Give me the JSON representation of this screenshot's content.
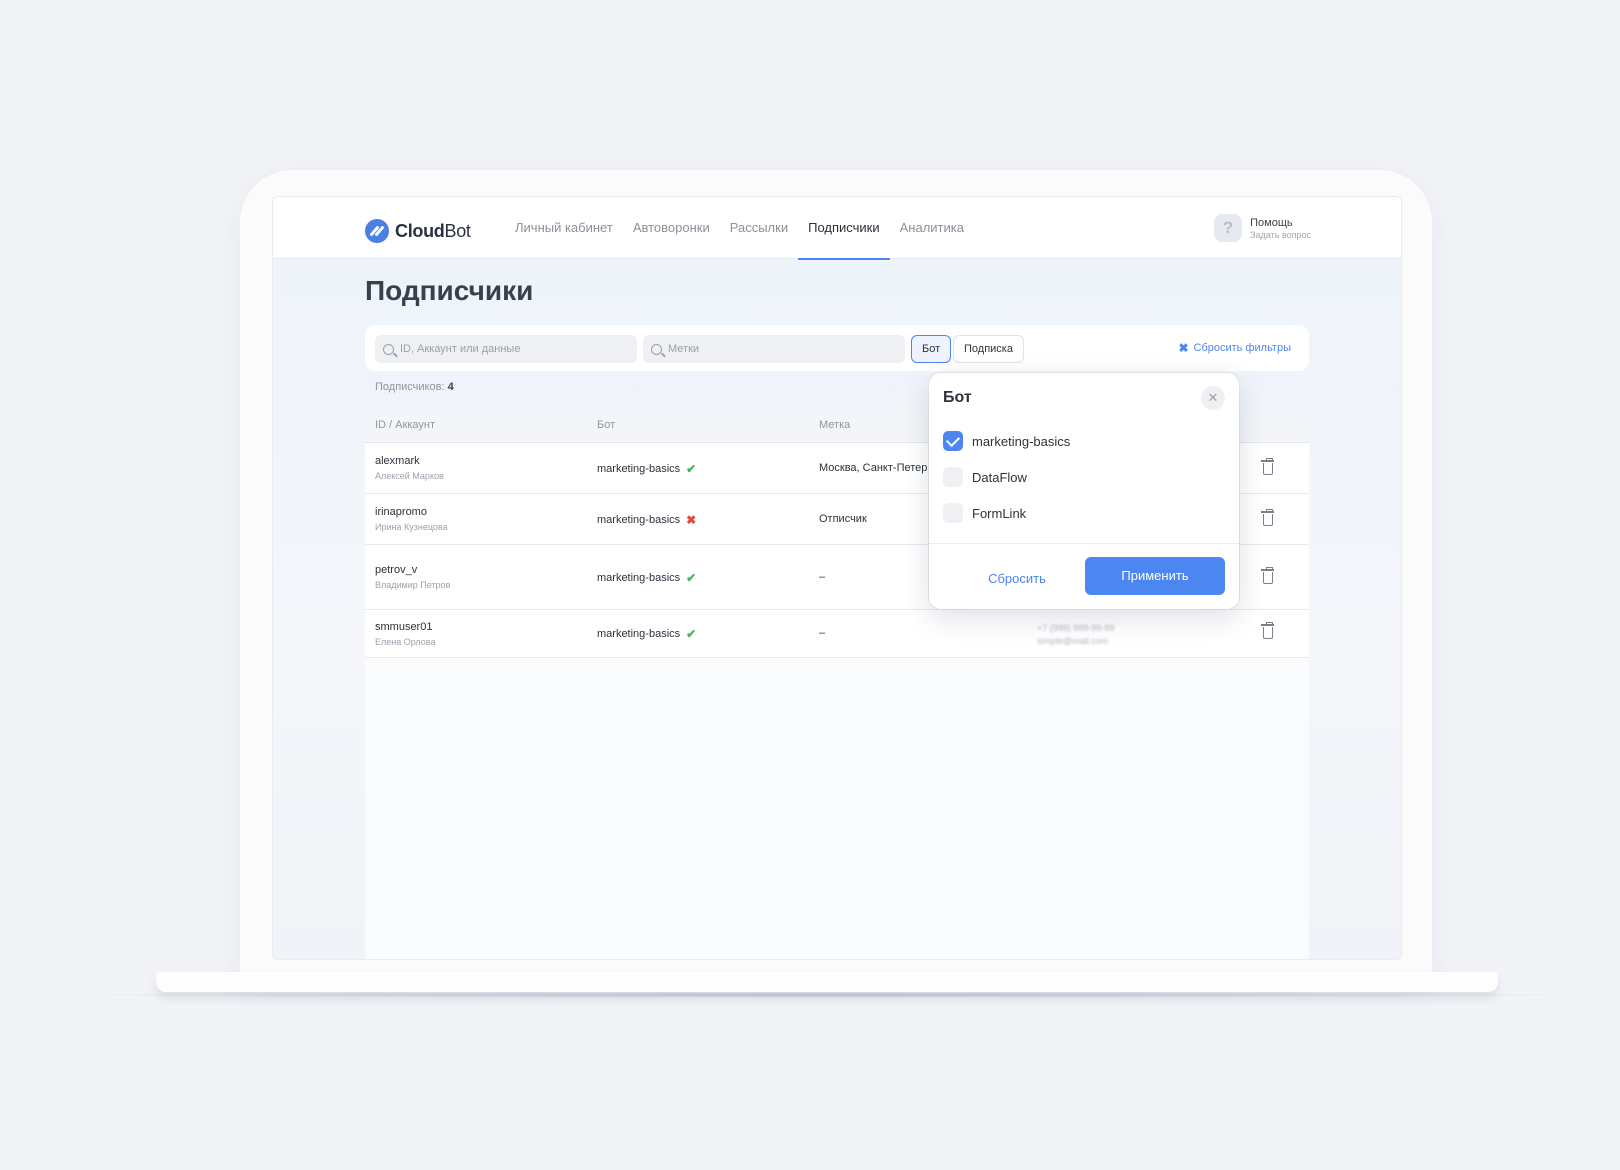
{
  "header": {
    "logo_bold": "Cloud",
    "logo_light": "Bot",
    "nav": [
      {
        "label": "Личный кабинет"
      },
      {
        "label": "Автоворонки"
      },
      {
        "label": "Рассылки"
      },
      {
        "label": "Подписчики",
        "active": true
      },
      {
        "label": "Аналитика"
      }
    ],
    "help_title": "Помощь",
    "help_sub": "Задать вопрос",
    "help_icon": "?"
  },
  "page": {
    "title": "Подписчики"
  },
  "filters": {
    "search_placeholder": "ID, Аккаунт или данные",
    "tags_placeholder": "Метки",
    "chip_bot": "Бот",
    "chip_subscription": "Подписка",
    "reset_label": "Сбросить фильтры"
  },
  "count": {
    "label": "Подписчиков:",
    "value": "4"
  },
  "table": {
    "columns": [
      "ID / Аккаунт",
      "Бот",
      "Метка"
    ],
    "rows": [
      {
        "account": "alexmark",
        "name": "Алексей Марков",
        "bot": "marketing-basics",
        "status": "ok",
        "tag": "Москва, Санкт-Петер",
        "phone": "",
        "email": ""
      },
      {
        "account": "irinapromo",
        "name": "Ирина Кузнецова",
        "bot": "marketing-basics",
        "status": "error",
        "tag": "Отписчик",
        "phone": "",
        "email": ""
      },
      {
        "account": "petrov_v",
        "name": "Владимир Петров",
        "bot": "marketing-basics",
        "status": "ok",
        "tag": "–",
        "phone": "",
        "email": ""
      },
      {
        "account": "smmuser01",
        "name": "Елена Орлова",
        "bot": "marketing-basics",
        "status": "ok",
        "tag": "–",
        "phone": "+7 (999) 999-99-99",
        "email": "simple@mail.com"
      }
    ]
  },
  "popup": {
    "title": "Бот",
    "options": [
      {
        "label": "marketing-basics",
        "checked": true
      },
      {
        "label": "DataFlow",
        "checked": false
      },
      {
        "label": "FormLink",
        "checked": false
      }
    ],
    "reset_label": "Сбросить",
    "apply_label": "Применить"
  },
  "colors": {
    "accent": "#4c86f0",
    "ok": "#46b35a",
    "error": "#e2493e"
  },
  "icons": {
    "ok": "✔",
    "error": "✖",
    "close": "✕"
  }
}
